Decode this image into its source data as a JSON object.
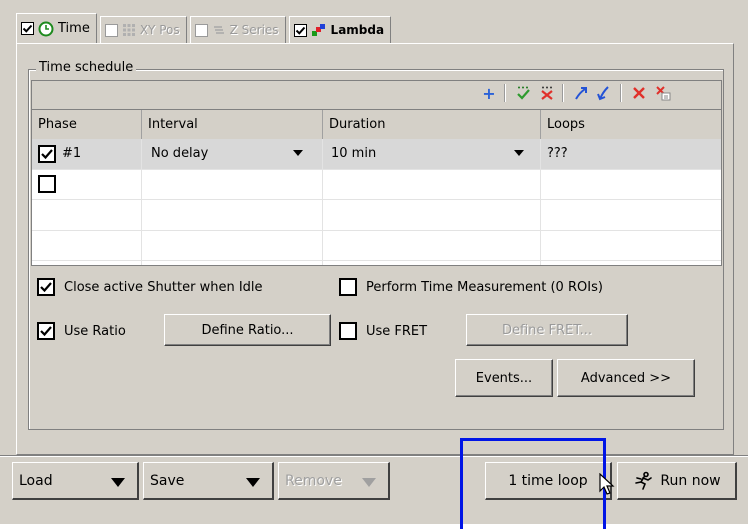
{
  "tabs": [
    {
      "label": "Time",
      "checked": true,
      "enabled": true,
      "icon": "clock-icon"
    },
    {
      "label": "XY Pos",
      "checked": false,
      "enabled": false,
      "icon": "grid-icon"
    },
    {
      "label": "Z Series",
      "checked": false,
      "enabled": false,
      "icon": "stack-icon"
    },
    {
      "label": "Lambda",
      "checked": true,
      "enabled": true,
      "icon": "lambda-icon"
    }
  ],
  "schedule": {
    "group_title": "Time schedule",
    "toolbar": [
      "add-icon",
      "move-down-icon",
      "delete-rows-icon",
      "move-up-icon",
      "insert-icon",
      "remove-icon",
      "clear-icon"
    ],
    "columns": [
      "Phase",
      "Interval",
      "Duration",
      "Loops"
    ],
    "rows": [
      {
        "checked": true,
        "phase": "#1",
        "interval": "No delay",
        "duration": "10 min",
        "loops": "???"
      },
      {
        "checked": false,
        "phase": "",
        "interval": "",
        "duration": "",
        "loops": ""
      }
    ]
  },
  "options": {
    "close_shutter": {
      "label": "Close active Shutter when Idle",
      "checked": true
    },
    "time_measurement": {
      "label": "Perform Time Measurement (0 ROIs)",
      "checked": false
    },
    "use_ratio": {
      "label": "Use Ratio",
      "checked": true
    },
    "define_ratio": "Define Ratio...",
    "use_fret": {
      "label": "Use FRET",
      "checked": false
    },
    "define_fret": "Define FRET...",
    "events": "Events...",
    "advanced": "Advanced >>"
  },
  "bottom": {
    "load": "Load",
    "save": "Save",
    "remove": "Remove",
    "loop_button": "1 time loop",
    "run_now": "Run now"
  }
}
